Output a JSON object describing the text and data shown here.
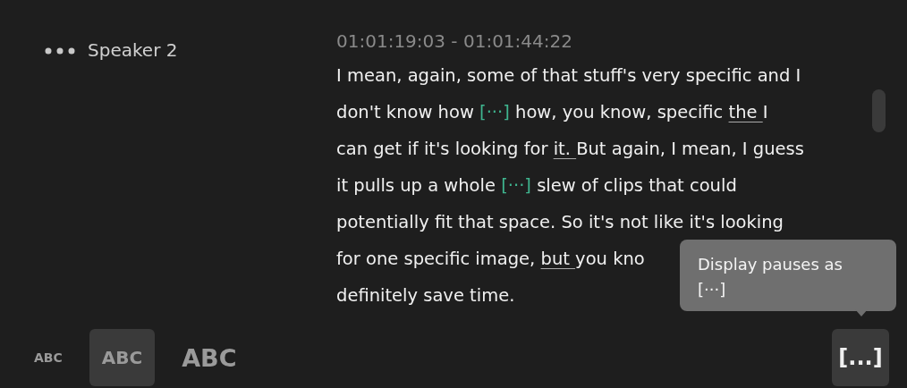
{
  "speaker": {
    "name": "Speaker 2"
  },
  "segment": {
    "timecode": "01:01:19:03 - 01:01:44:22",
    "lines": [
      [
        {
          "kind": "text",
          "text": "I mean, again, some of that stuff's very specific and I"
        }
      ],
      [
        {
          "kind": "text",
          "text": "don't know how "
        },
        {
          "kind": "pause",
          "text": "[···]"
        },
        {
          "kind": "text",
          "text": " how, you know, specific "
        },
        {
          "kind": "underline",
          "text": "the "
        },
        {
          "kind": "text",
          "text": "I"
        }
      ],
      [
        {
          "kind": "text",
          "text": "can get if it's looking for "
        },
        {
          "kind": "underline",
          "text": "it. "
        },
        {
          "kind": "text",
          "text": "But again, I mean, I guess"
        }
      ],
      [
        {
          "kind": "text",
          "text": "it pulls up a whole "
        },
        {
          "kind": "pause",
          "text": "[···]"
        },
        {
          "kind": "text",
          "text": " slew of clips that could"
        }
      ],
      [
        {
          "kind": "text",
          "text": "potentially fit that space. So it's not like it's looking"
        }
      ],
      [
        {
          "kind": "text",
          "text": "for one specific image, "
        },
        {
          "kind": "underline",
          "text": "but "
        },
        {
          "kind": "text",
          "text": "you kno"
        }
      ],
      [
        {
          "kind": "text",
          "text": "definitely save time."
        }
      ]
    ]
  },
  "text_sizes": [
    {
      "label": "ABC",
      "kind": "small",
      "selected": false
    },
    {
      "label": "ABC",
      "kind": "medium",
      "selected": true
    },
    {
      "label": "ABC",
      "kind": "large",
      "selected": false
    }
  ],
  "tooltip": {
    "text": "Display pauses as [···]"
  },
  "pause_button": {
    "label": "[...]"
  }
}
